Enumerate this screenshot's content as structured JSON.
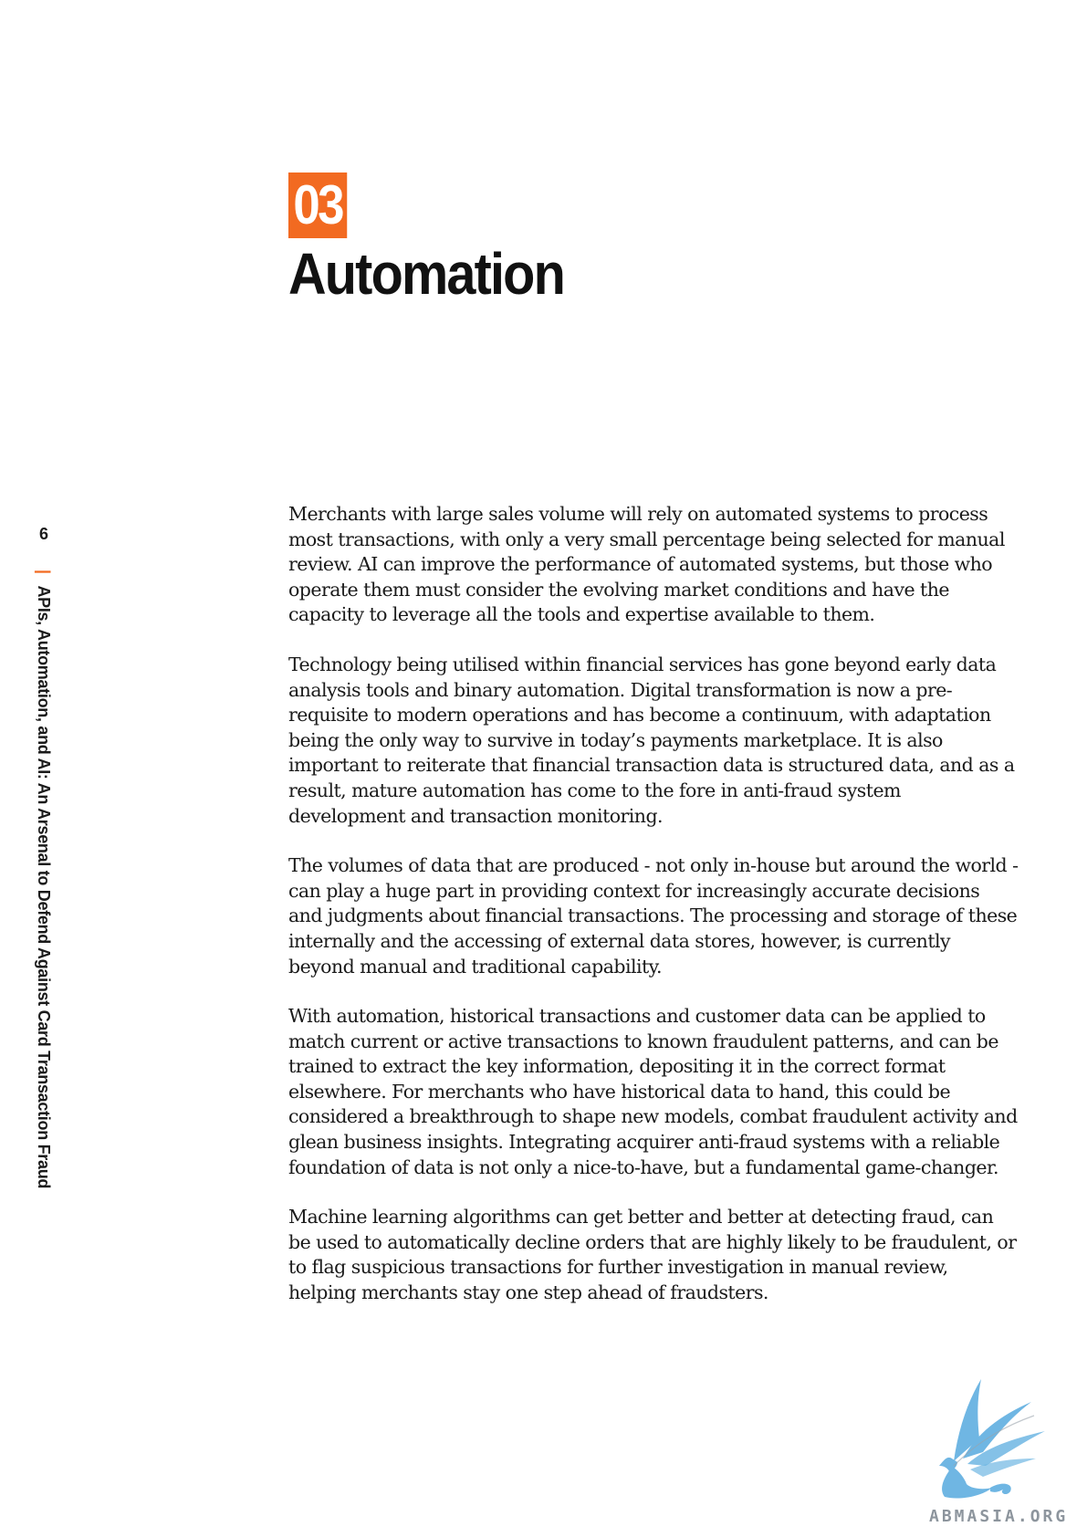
{
  "section": {
    "number": "03",
    "title": "Automation"
  },
  "sidebar": {
    "page_number": "6",
    "divider": "|",
    "running_title": "APIs, Automation, and AI: An Arsenal to Defend Against Card Transaction Fraud"
  },
  "paragraphs": [
    "Merchants with large sales volume will rely on automated systems to process most transactions, with only a very small percentage being selected for manual review. AI can improve the performance of automated systems, but those who operate them must consider the evolving market conditions and have the capacity to leverage all the tools and expertise available to them.",
    "Technology being utilised within financial services has gone beyond early data analysis tools and binary automation. Digital transformation is now a pre-requisite to modern operations and has become a continuum, with adaptation being the only way to survive in today’s payments marketplace. It is also important to reiterate that financial transaction data is structured data, and as a result, mature automation has come to the fore in anti-fraud system development and transaction monitoring.",
    "The volumes of data that are produced - not only in-house but around the world - can play a huge part in providing context for increasingly accurate decisions and judgments about financial transactions. The processing and storage of these internally and the accessing of external data stores, however, is currently beyond manual and traditional capability.",
    "With automation, historical transactions and customer data can be applied to match current or active transactions to known fraudulent patterns, and can be trained to extract the key information, depositing it in the correct format elsewhere. For merchants who have historical data to hand, this could be considered a breakthrough to shape new models, combat fraudulent activity and glean business insights. Integrating acquirer anti-fraud systems with a reliable foundation of data is not only a nice-to-have, but a fundamental game-changer.",
    "Machine learning algorithms can get better and better at detecting fraud, can be used to automatically decline orders that are highly likely to be fraudulent, or to flag suspicious transactions for further investigation in manual review, helping merchants stay one step ahead of fraudsters."
  ],
  "watermark": {
    "text": "ABMASIA.ORG",
    "icon": "griffin-icon",
    "color": "#6fb6e3"
  },
  "colors": {
    "accent": "#f26a21",
    "text": "#1a1a1a",
    "watermark_text": "#8d959d"
  }
}
